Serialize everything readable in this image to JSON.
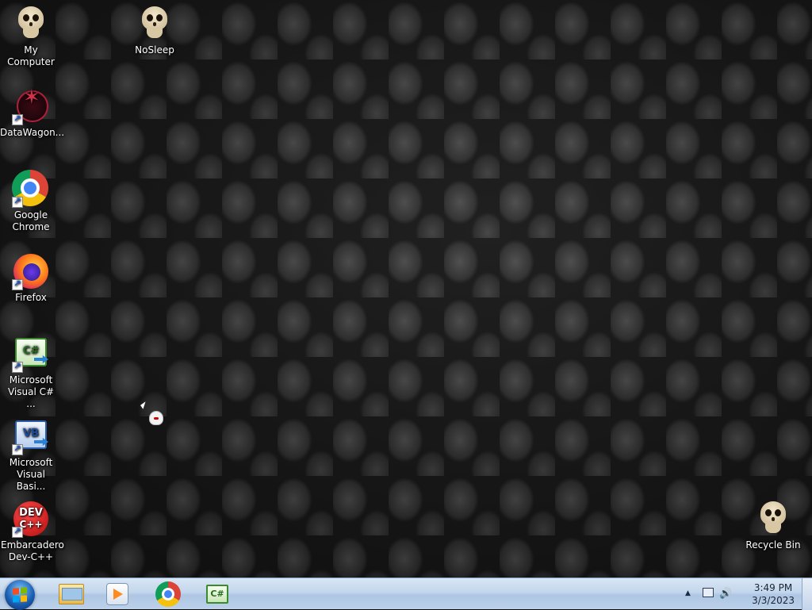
{
  "desktop": {
    "icons": [
      {
        "label": "My Computer",
        "icon": "skull-icon"
      },
      {
        "label": "NoSleep",
        "icon": "skull-icon"
      },
      {
        "label": "DataWagon...",
        "icon": "pentagram-icon"
      },
      {
        "label": "Google Chrome",
        "icon": "chrome-icon"
      },
      {
        "label": "Firefox",
        "icon": "firefox-icon"
      },
      {
        "label": "Microsoft Visual C# ...",
        "icon": "csharp-icon"
      },
      {
        "label": "Microsoft Visual Basi...",
        "icon": "vb-icon"
      },
      {
        "label": "Embarcadero Dev-C++",
        "icon": "devcpp-icon"
      },
      {
        "label": "Recycle Bin",
        "icon": "skull-icon"
      }
    ],
    "csharp_glyph": "C#",
    "vb_glyph": "VB",
    "devcpp_glyph_top": "DEV",
    "devcpp_glyph_bottom": "C++"
  },
  "taskbar": {
    "start_icon": "windows-start-orb",
    "pinned": [
      {
        "name": "Windows Explorer",
        "icon": "folder-explorer-icon"
      },
      {
        "name": "Windows Media Player",
        "icon": "media-player-icon"
      },
      {
        "name": "Google Chrome",
        "icon": "chrome-icon"
      },
      {
        "name": "Microsoft Visual C#",
        "icon": "csharp-icon",
        "glyph": "C#"
      }
    ],
    "tray": {
      "chevron": "▲",
      "volume": "🔊",
      "time": "3:49 PM",
      "date": "3/3/2023"
    }
  }
}
